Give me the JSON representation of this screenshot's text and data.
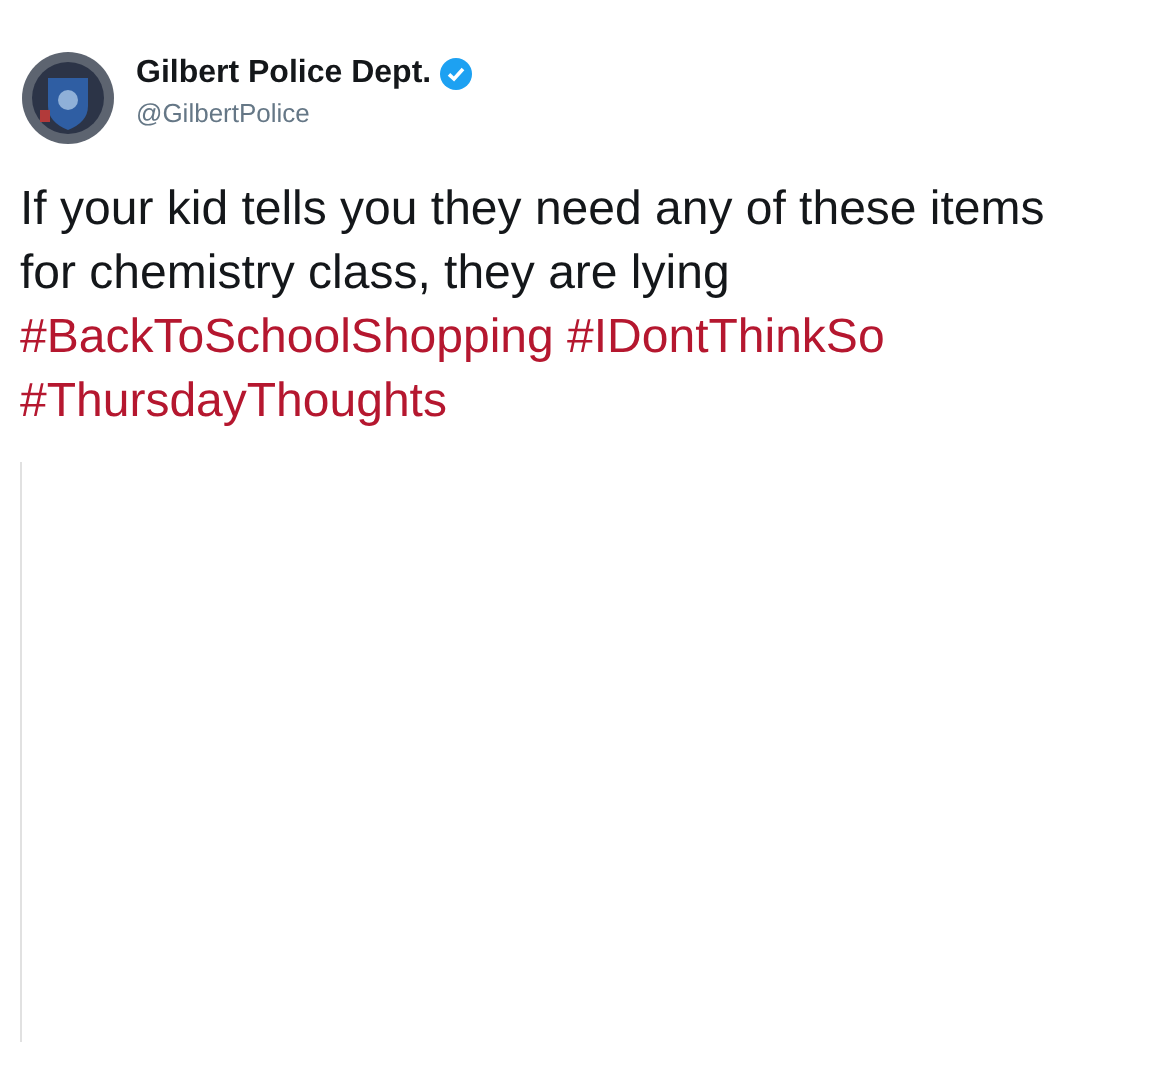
{
  "author": {
    "name": "Gilbert Police Dept.",
    "verified": true,
    "handle": "@GilbertPolice"
  },
  "tweet": [
    {
      "kind": "text",
      "text": "If your kid tells you they need any of these items for chemistry class, they are lying"
    },
    {
      "kind": "hashtag",
      "text": "#BackToSchoolShopping"
    },
    {
      "kind": "hashtag",
      "text": "#IDontThinkSo"
    },
    {
      "kind": "hashtag",
      "text": "#ThursdayThoughts"
    }
  ]
}
